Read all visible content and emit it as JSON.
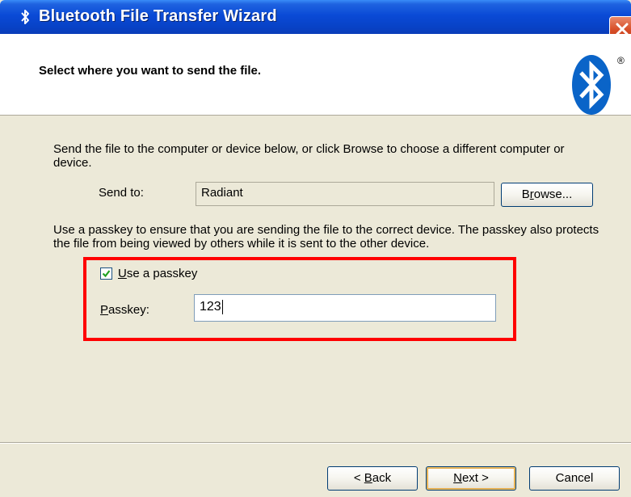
{
  "window": {
    "title": "Bluetooth File Transfer Wizard"
  },
  "header": {
    "title": "Select where you want to send the file.",
    "logo_mark": "®"
  },
  "send_section": {
    "intro": "Send the file to the computer or device below, or click Browse to choose a different computer or device.",
    "send_to_label": "Send to:",
    "send_to_value": "Radiant",
    "browse_label_pre": "B",
    "browse_label_u": "r",
    "browse_label_post": "owse..."
  },
  "passkey_section": {
    "description": "Use a passkey to ensure that you are sending the file to the correct device. The passkey also protects the file from being viewed by others while it is sent to the other device.",
    "checkbox_u": "U",
    "checkbox_rest": "se a passkey",
    "checkbox_checked": true,
    "passkey_label_u": "P",
    "passkey_label_rest": "asskey:",
    "passkey_value": "123"
  },
  "footer": {
    "back_prefix": "< ",
    "back_u": "B",
    "back_rest": "ack",
    "next_u": "N",
    "next_rest": "ext >",
    "cancel": "Cancel"
  },
  "colors": {
    "title_bar": "#0a4ad6",
    "dialog_bg": "#ece9d8",
    "highlight": "#ff0000",
    "checkmark": "#21a121",
    "bluetooth": "#0a64c8"
  },
  "icons": [
    "bluetooth-icon",
    "close-icon",
    "bluetooth-logo",
    "checkmark-icon"
  ]
}
